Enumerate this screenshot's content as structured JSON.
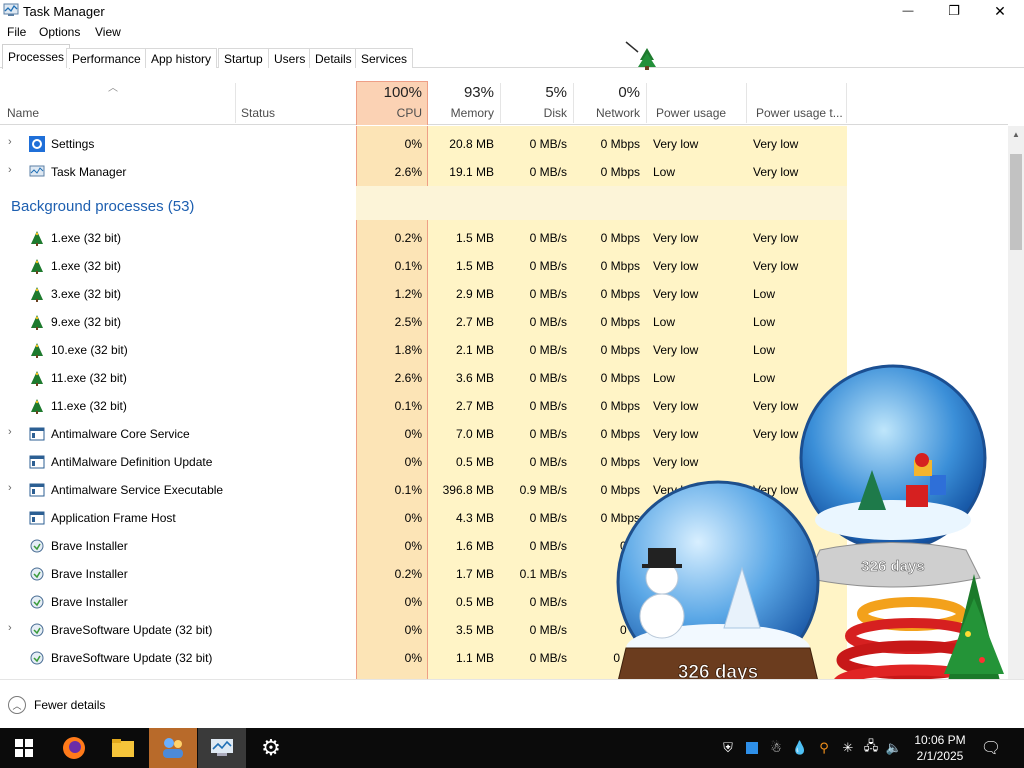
{
  "window": {
    "title": "Task Manager",
    "minimize_glyph": "—",
    "maximize_glyph": "❐",
    "close_glyph": "✕"
  },
  "menu": [
    "File",
    "Options",
    "View"
  ],
  "tabs": [
    "Processes",
    "Performance",
    "App history",
    "Startup",
    "Users",
    "Details",
    "Services"
  ],
  "columns": {
    "name": "Name",
    "status": "Status",
    "cpu": {
      "pct": "100%",
      "label": "CPU"
    },
    "memory": {
      "pct": "93%",
      "label": "Memory"
    },
    "disk": {
      "pct": "5%",
      "label": "Disk"
    },
    "network": {
      "pct": "0%",
      "label": "Network"
    },
    "power": "Power usage",
    "power_trend": "Power usage t..."
  },
  "apps": [
    {
      "name": "Settings",
      "cpu": "0%",
      "memory": "20.8 MB",
      "disk": "0 MB/s",
      "network": "0 Mbps",
      "power": "Very low",
      "trend": "Very low",
      "icon": "gear-icon"
    },
    {
      "name": "Task Manager",
      "cpu": "2.6%",
      "memory": "19.1 MB",
      "disk": "0 MB/s",
      "network": "0 Mbps",
      "power": "Low",
      "trend": "Very low",
      "icon": "task-manager-icon"
    }
  ],
  "background_group": {
    "label": "Background processes (53)"
  },
  "background": [
    {
      "name": "1.exe (32 bit)",
      "cpu": "0.2%",
      "memory": "1.5 MB",
      "disk": "0 MB/s",
      "network": "0 Mbps",
      "power": "Very low",
      "trend": "Very low",
      "icon": "tree-icon",
      "expand": false
    },
    {
      "name": "1.exe (32 bit)",
      "cpu": "0.1%",
      "memory": "1.5 MB",
      "disk": "0 MB/s",
      "network": "0 Mbps",
      "power": "Very low",
      "trend": "Very low",
      "icon": "tree-icon",
      "expand": false
    },
    {
      "name": "3.exe (32 bit)",
      "cpu": "1.2%",
      "memory": "2.9 MB",
      "disk": "0 MB/s",
      "network": "0 Mbps",
      "power": "Very low",
      "trend": "Low",
      "icon": "tree-icon",
      "expand": false
    },
    {
      "name": "9.exe (32 bit)",
      "cpu": "2.5%",
      "memory": "2.7 MB",
      "disk": "0 MB/s",
      "network": "0 Mbps",
      "power": "Low",
      "trend": "Low",
      "icon": "tree-icon",
      "expand": false
    },
    {
      "name": "10.exe (32 bit)",
      "cpu": "1.8%",
      "memory": "2.1 MB",
      "disk": "0 MB/s",
      "network": "0 Mbps",
      "power": "Very low",
      "trend": "Low",
      "icon": "tree-icon",
      "expand": false
    },
    {
      "name": "11.exe (32 bit)",
      "cpu": "2.6%",
      "memory": "3.6 MB",
      "disk": "0 MB/s",
      "network": "0 Mbps",
      "power": "Low",
      "trend": "Low",
      "icon": "tree-icon",
      "expand": false
    },
    {
      "name": "11.exe (32 bit)",
      "cpu": "0.1%",
      "memory": "2.7 MB",
      "disk": "0 MB/s",
      "network": "0 Mbps",
      "power": "Very low",
      "trend": "Very low",
      "icon": "tree-icon",
      "expand": false
    },
    {
      "name": "Antimalware Core Service",
      "cpu": "0%",
      "memory": "7.0 MB",
      "disk": "0 MB/s",
      "network": "0 Mbps",
      "power": "Very low",
      "trend": "Very low",
      "icon": "service-icon",
      "expand": true
    },
    {
      "name": "AntiMalware Definition Update",
      "cpu": "0%",
      "memory": "0.5 MB",
      "disk": "0 MB/s",
      "network": "0 Mbps",
      "power": "Very low",
      "trend": "",
      "icon": "service-icon",
      "expand": false
    },
    {
      "name": "Antimalware Service Executable",
      "cpu": "0.1%",
      "memory": "396.8 MB",
      "disk": "0.9 MB/s",
      "network": "0 Mbps",
      "power": "Very low",
      "trend": "Very low",
      "icon": "service-icon",
      "expand": true
    },
    {
      "name": "Application Frame Host",
      "cpu": "0%",
      "memory": "4.3 MB",
      "disk": "0 MB/s",
      "network": "0 Mbps",
      "power": "",
      "trend": "",
      "icon": "service-icon",
      "expand": false
    },
    {
      "name": "Brave Installer",
      "cpu": "0%",
      "memory": "1.6 MB",
      "disk": "0 MB/s",
      "network": "0 M",
      "power": "",
      "trend": "",
      "icon": "installer-icon",
      "expand": false
    },
    {
      "name": "Brave Installer",
      "cpu": "0.2%",
      "memory": "1.7 MB",
      "disk": "0.1 MB/s",
      "network": "0 M",
      "power": "",
      "trend": "",
      "icon": "installer-icon",
      "expand": false
    },
    {
      "name": "Brave Installer",
      "cpu": "0%",
      "memory": "0.5 MB",
      "disk": "0 MB/s",
      "network": "0 M",
      "power": "",
      "trend": "",
      "icon": "installer-icon",
      "expand": false
    },
    {
      "name": "BraveSoftware Update (32 bit)",
      "cpu": "0%",
      "memory": "3.5 MB",
      "disk": "0 MB/s",
      "network": "0 M",
      "power": "",
      "trend": "",
      "icon": "installer-icon",
      "expand": true
    },
    {
      "name": "BraveSoftware Update (32 bit)",
      "cpu": "0%",
      "memory": "1.1 MB",
      "disk": "0 MB/s",
      "network": "0 Mb",
      "power": "",
      "trend": "",
      "icon": "installer-icon",
      "expand": false
    }
  ],
  "footer": {
    "fewer_details": "Fewer details"
  },
  "globes": {
    "left_days": "326 days",
    "right_days": "326 days"
  },
  "taskbar": {
    "time": "10:06 PM",
    "date": "2/1/2025",
    "apps": [
      "windows-start-icon",
      "firefox-icon",
      "file-explorer-icon",
      "people-icon",
      "task-manager-icon",
      "settings-icon"
    ]
  },
  "colors": {
    "cpu_header": "#fbd2b4",
    "cpu_column": "#fce4b6",
    "heat_light": "#fff4c6",
    "heat_medium": "#fbe9a5",
    "heat_strong": "#f9e08c",
    "group_blue": "#1d5fb0",
    "taskbar": "#0b0b0b"
  }
}
